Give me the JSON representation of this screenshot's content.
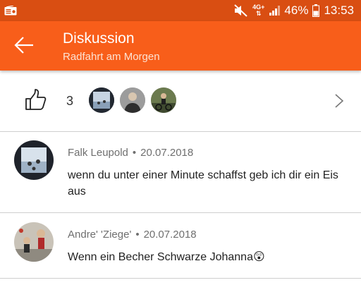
{
  "status_bar": {
    "network_label": "4G+",
    "battery": "46%",
    "time": "13:53"
  },
  "header": {
    "title": "Diskussion",
    "subtitle": "Radfahrt am Morgen"
  },
  "kudos": {
    "count": "3"
  },
  "comments": [
    {
      "author": "Falk Leupold",
      "date": "20.07.2018",
      "text": "wenn du unter einer Minute schaffst geb ich dir ein Eis aus"
    },
    {
      "author": "Andre' 'Ziege'",
      "date": "20.07.2018",
      "text": "Wenn ein Becher Schwarze Johanna😲"
    }
  ],
  "separator": "•",
  "colors": {
    "status_bar": "#d94e12",
    "app_bar": "#f85e1a"
  }
}
